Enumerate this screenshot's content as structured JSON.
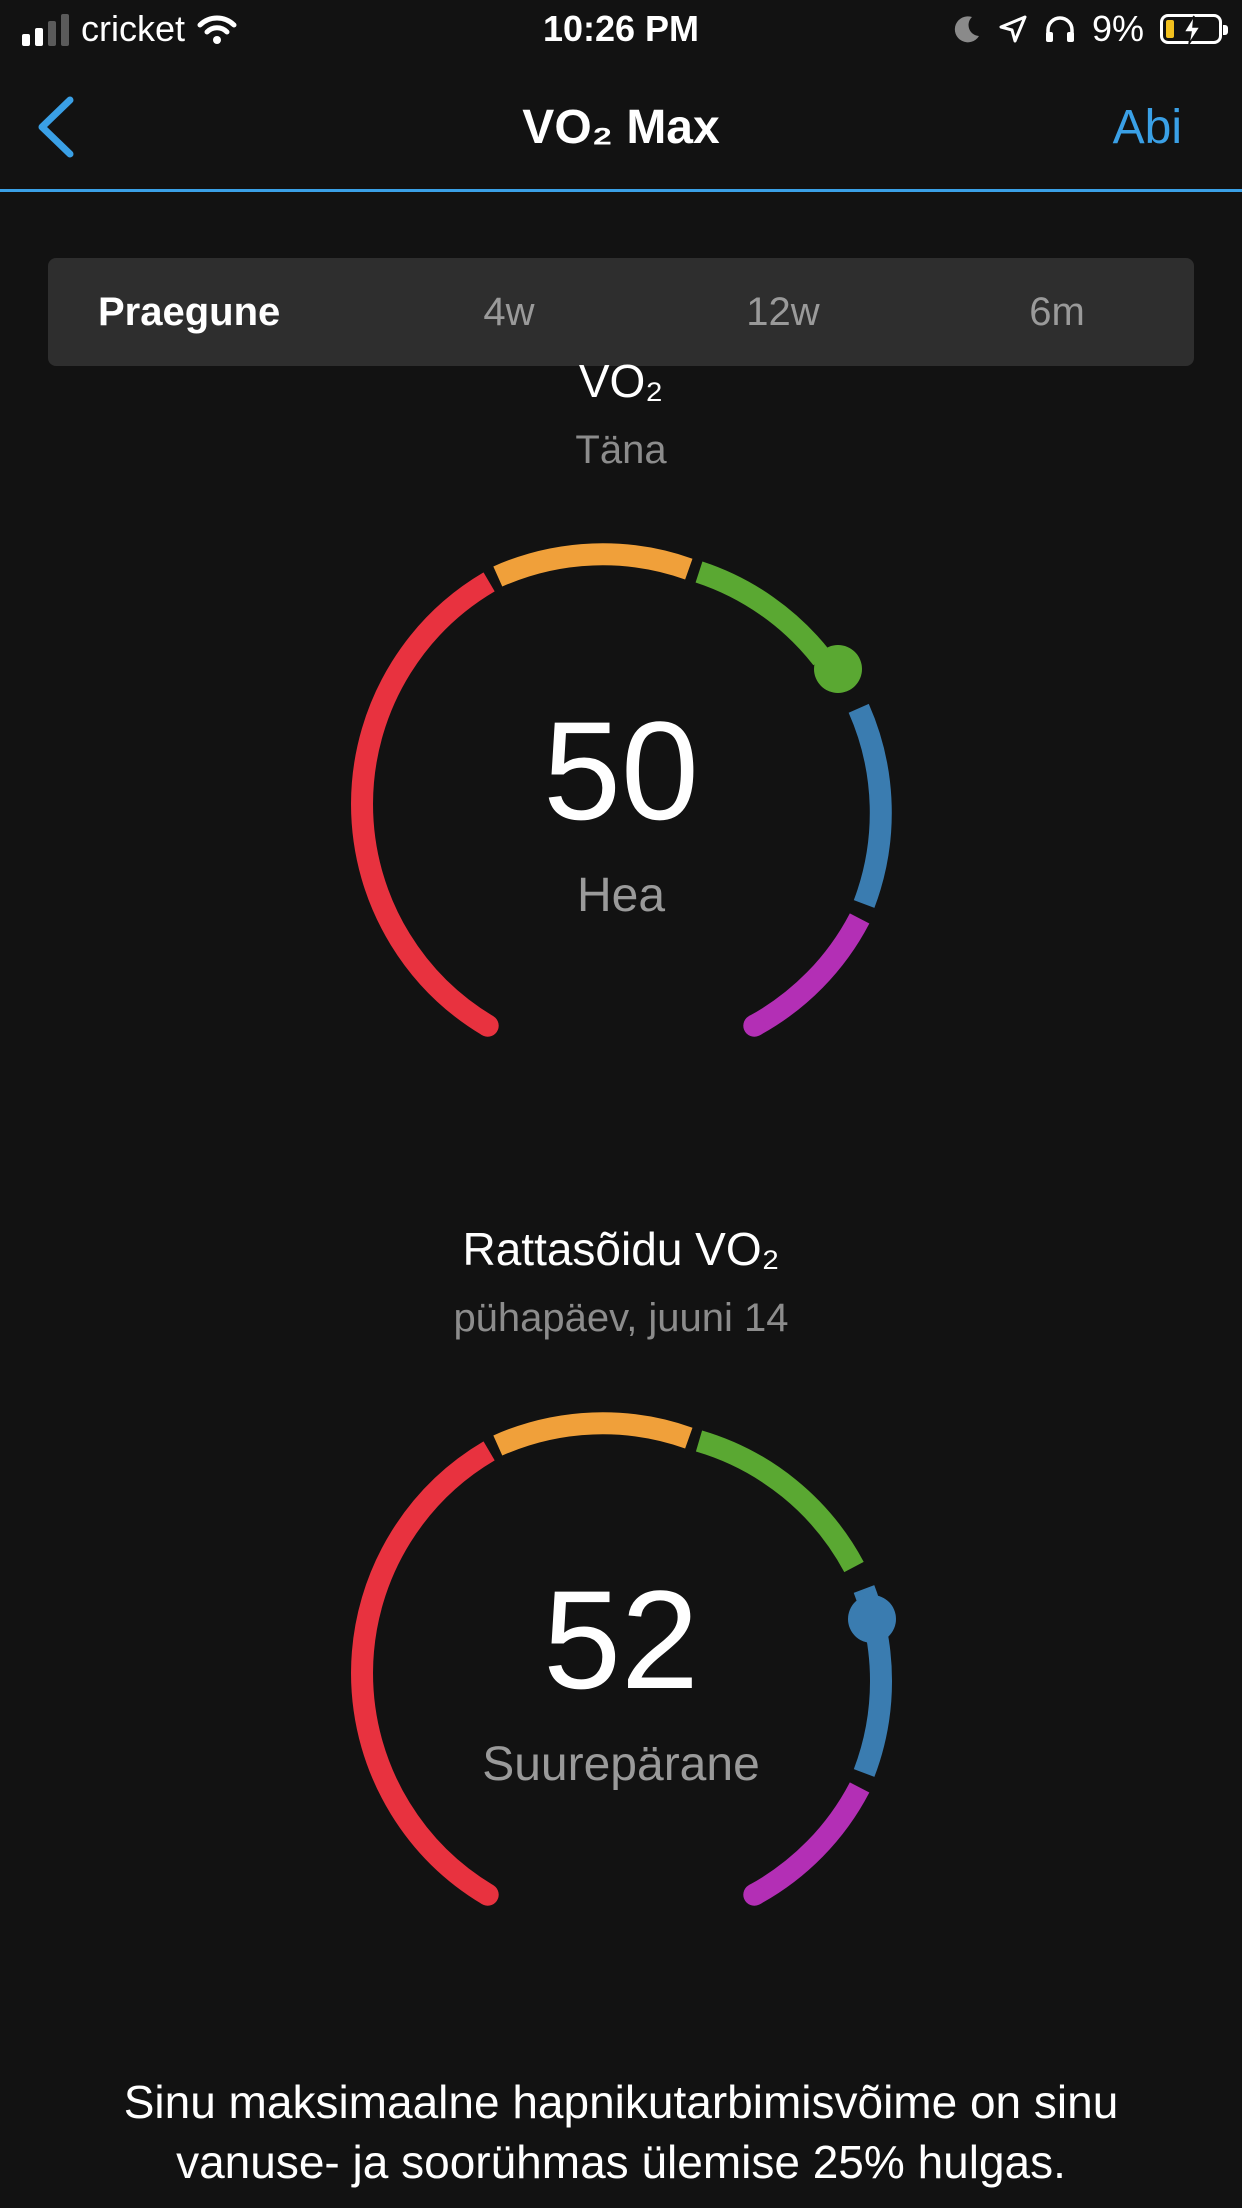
{
  "status_bar": {
    "carrier": "cricket",
    "time": "10:26 PM",
    "battery": "9%"
  },
  "nav": {
    "title": "VO₂ Max",
    "action": "Abi"
  },
  "tabs": [
    {
      "label": "Praegune",
      "active": true
    },
    {
      "label": "4w",
      "active": false
    },
    {
      "label": "12w",
      "active": false
    },
    {
      "label": "6m",
      "active": false
    }
  ],
  "vo2": {
    "title": "VO₂",
    "subtitle": "Täna",
    "value": "50",
    "rating": "Hea",
    "marker_color": "#5aa832"
  },
  "cycling": {
    "title": "Rattasõidu VO₂",
    "subtitle": "pühapäev, juuni 14",
    "value": "52",
    "rating": "Suurepärane",
    "marker_color": "#3a7cb0"
  },
  "description": "Sinu maksimaalne hapnikutarbimisvõime on sinu vanuse- ja soorühmas ülemise 25% hulgas.",
  "colors": {
    "accent": "#3aa0e6",
    "poor": "#e8323f",
    "fair": "#f0a03a",
    "good": "#5aa832",
    "excellent": "#3a7cb0",
    "superior": "#b32fb5"
  }
}
